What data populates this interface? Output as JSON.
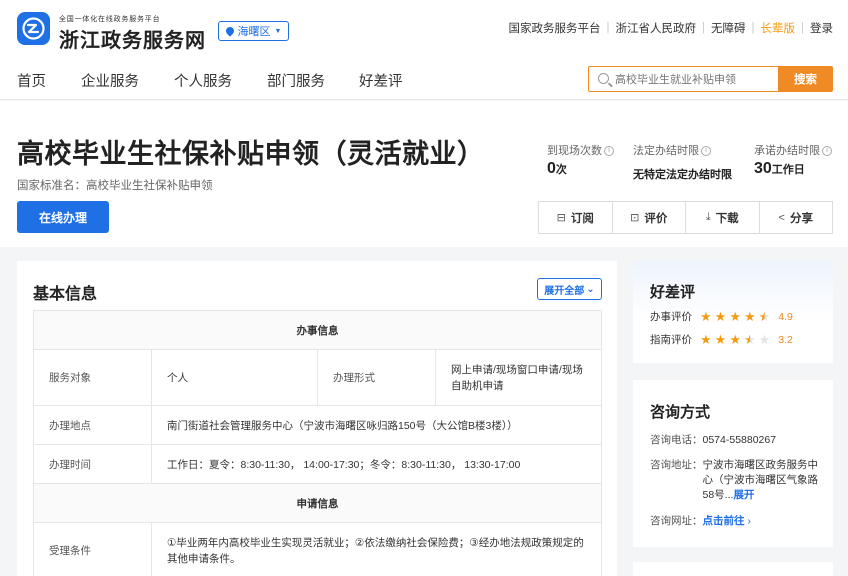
{
  "header": {
    "logo_subtitle": "全国一体化在线政务服务平台",
    "logo_title": "浙江政务服务网",
    "region": "海曙区",
    "links": [
      {
        "label": "国家政务服务平台",
        "highlight": false
      },
      {
        "label": "浙江省人民政府",
        "highlight": false
      },
      {
        "label": "无障碍",
        "highlight": false
      },
      {
        "label": "长辈版",
        "highlight": true
      },
      {
        "label": "登录",
        "highlight": false
      }
    ]
  },
  "nav": {
    "items": [
      "首页",
      "企业服务",
      "个人服务",
      "部门服务",
      "好差评"
    ],
    "search_placeholder": "高校毕业生就业补贴申领",
    "search_button": "搜索"
  },
  "service": {
    "title": "高校毕业生社保补贴申领（灵活就业）",
    "standard_name": "国家标准名：高校毕业生社保补贴申领",
    "online_button": "在线办理",
    "stats": [
      {
        "label": "到现场次数",
        "value": "0",
        "unit": "次"
      },
      {
        "label": "法定办结时限",
        "value": "无特定法定办结时限",
        "unit": ""
      },
      {
        "label": "承诺办结时限",
        "value": "30",
        "unit": "工作日"
      }
    ],
    "actions": [
      {
        "icon": "bookmark-icon",
        "label": "订阅"
      },
      {
        "icon": "comment-icon",
        "label": "评价"
      },
      {
        "icon": "download-icon",
        "label": "下载"
      },
      {
        "icon": "share-icon",
        "label": "分享"
      }
    ]
  },
  "basic_info": {
    "title": "基本信息",
    "expand_label": "展开全部",
    "section_handling": "办事信息",
    "service_target_label": "服务对象",
    "service_target_value": "个人",
    "handling_form_label": "办理形式",
    "handling_form_value": "网上申请/现场窗口申请/现场自助机申请",
    "location_label": "办理地点",
    "location_value": "南门街道社会管理服务中心（宁波市海曙区咏归路150号（大公馆B楼3楼））",
    "time_label": "办理时间",
    "time_value": "工作日：夏令：8:30-11:30， 14:00-17:30；冬令：8:30-11:30， 13:30-17:00",
    "section_application": "申请信息",
    "condition_label": "受理条件",
    "condition_value": "①毕业两年内高校毕业生实现灵活就业；②依法缴纳社会保险费；③经办地法规政策规定的其他申请条件。"
  },
  "evaluation": {
    "title": "好差评",
    "rows": [
      {
        "label": "办事评价",
        "rating": 4.5,
        "score": "4.9"
      },
      {
        "label": "指南评价",
        "rating": 3.5,
        "score": "3.2"
      }
    ]
  },
  "consult": {
    "title": "咨询方式",
    "phone_label": "咨询电话：",
    "phone": "0574-55880267",
    "address_label": "咨询地址：",
    "address": "宁波市海曙区政务服务中心（宁波市海曙区气象路58号...",
    "address_expand": "展开",
    "web_label": "咨询网址：",
    "web_link": "点击前往",
    "web_chevron": "›"
  },
  "colors": {
    "brand": "#1f6fe5",
    "accent": "#f08a24",
    "star": "#f39c12"
  }
}
